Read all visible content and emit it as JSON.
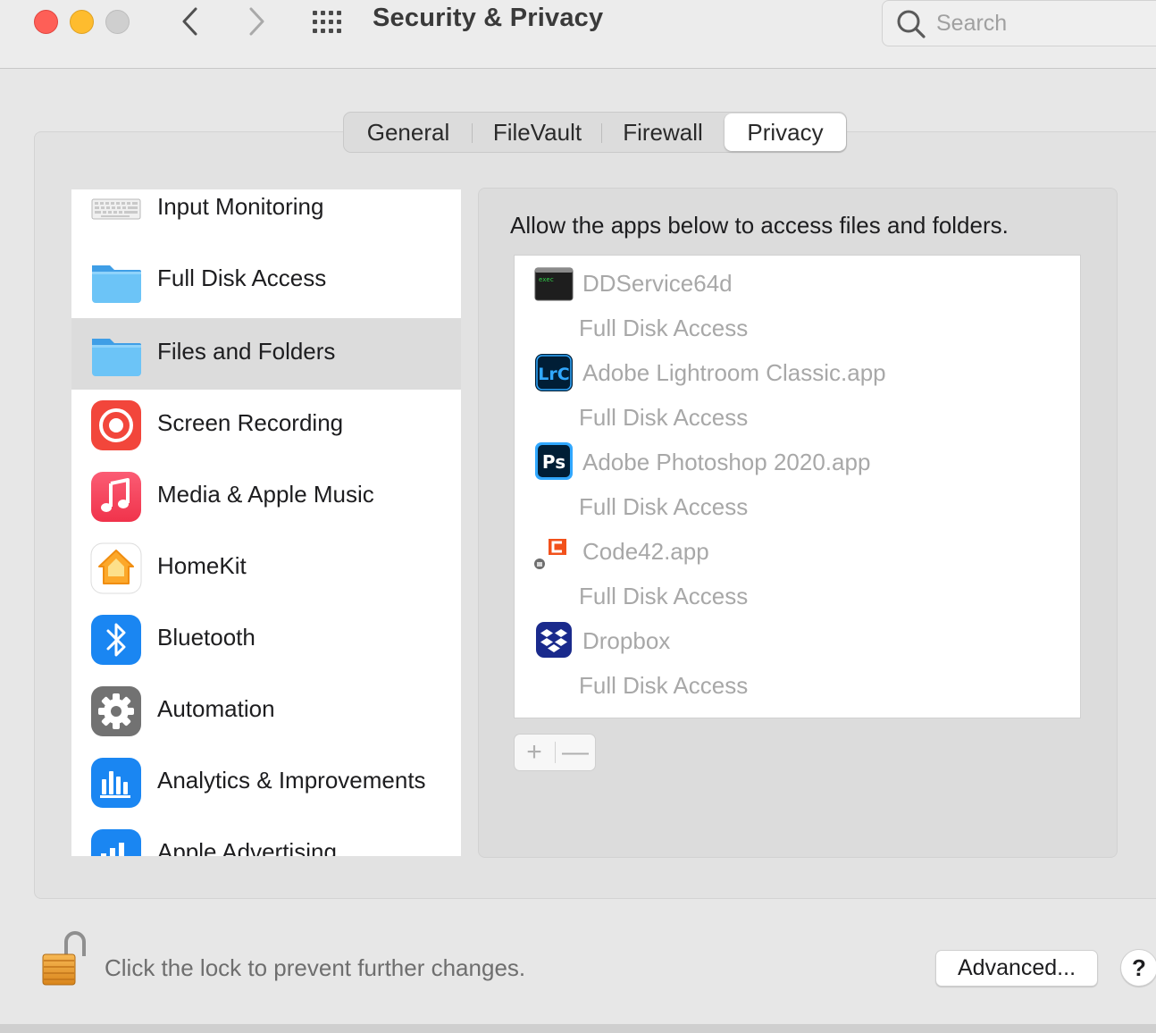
{
  "window": {
    "title": "Security & Privacy",
    "search_placeholder": "Search"
  },
  "tabs": [
    {
      "label": "General"
    },
    {
      "label": "FileVault"
    },
    {
      "label": "Firewall"
    },
    {
      "label": "Privacy",
      "selected": true
    }
  ],
  "sidebar": {
    "items": [
      {
        "label": "Input Monitoring",
        "icon": "keyboard-icon"
      },
      {
        "label": "Full Disk Access",
        "icon": "folder-icon"
      },
      {
        "label": "Files and Folders",
        "icon": "folder-icon",
        "selected": true
      },
      {
        "label": "Screen Recording",
        "icon": "screen-recording-icon"
      },
      {
        "label": "Media & Apple Music",
        "icon": "music-icon"
      },
      {
        "label": "HomeKit",
        "icon": "homekit-icon"
      },
      {
        "label": "Bluetooth",
        "icon": "bluetooth-icon"
      },
      {
        "label": "Automation",
        "icon": "gear-icon"
      },
      {
        "label": "Analytics & Improvements",
        "icon": "analytics-icon"
      },
      {
        "label": "Apple Advertising",
        "icon": "advertising-icon"
      }
    ]
  },
  "panel": {
    "heading": "Allow the apps below to access files and folders.",
    "apps": [
      {
        "name": "DDService64d",
        "access": "Full Disk Access",
        "icon": "terminal-exec-icon"
      },
      {
        "name": "Adobe Lightroom Classic.app",
        "access": "Full Disk Access",
        "icon": "lightroom-icon",
        "icon_text": "LrC"
      },
      {
        "name": "Adobe Photoshop 2020.app",
        "access": "Full Disk Access",
        "icon": "photoshop-icon",
        "icon_text": "Ps"
      },
      {
        "name": "Code42.app",
        "access": "Full Disk Access",
        "icon": "code42-icon"
      },
      {
        "name": "Dropbox",
        "access": "Full Disk Access",
        "icon": "dropbox-icon"
      }
    ],
    "add_label": "+",
    "remove_label": "—"
  },
  "footer": {
    "lock_text": "Click the lock to prevent further changes.",
    "advanced_label": "Advanced...",
    "help_label": "?"
  },
  "colors": {
    "close": "#fe5f57",
    "minimize": "#febc2e",
    "selected_row": "#dcdcdc",
    "disabled_text": "#a8a8a8"
  }
}
